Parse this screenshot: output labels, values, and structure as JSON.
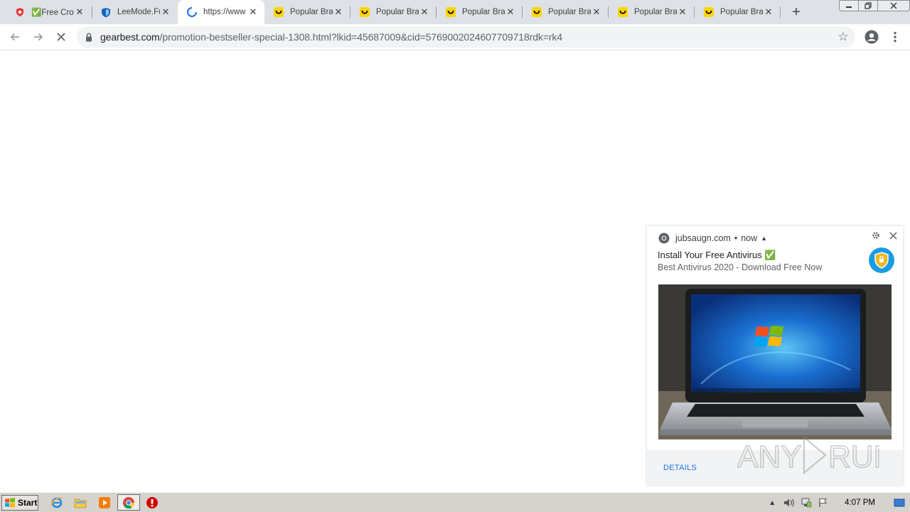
{
  "tabs": [
    {
      "title": "✅Free Cro",
      "favicon": "red-shield-icon",
      "active": false
    },
    {
      "title": "LeeMode.Fu",
      "favicon": "blue-shield-icon",
      "active": false
    },
    {
      "title": "https://www",
      "favicon": "loading-spinner-icon",
      "active": true
    },
    {
      "title": "Popular Bra",
      "favicon": "smiley-yellow-icon",
      "active": false
    },
    {
      "title": "Popular Bra",
      "favicon": "smiley-yellow-icon",
      "active": false
    },
    {
      "title": "Popular Bra",
      "favicon": "smiley-yellow-icon",
      "active": false
    },
    {
      "title": "Popular Bra",
      "favicon": "smiley-yellow-icon",
      "active": false
    },
    {
      "title": "Popular Bra",
      "favicon": "smiley-yellow-icon",
      "active": false
    },
    {
      "title": "Popular Bra",
      "favicon": "smiley-yellow-icon",
      "active": false
    }
  ],
  "omnibox": {
    "host": "gearbest.com",
    "path": "/promotion-bestseller-special-1308.html?lkid=45687009&cid=5769002024607709718rdk=rk4"
  },
  "notification": {
    "source": "jubsaugn.com",
    "time": "now",
    "title": "Install Your Free Antivirus ✅",
    "message": "Best Antivirus 2020 - Download Free Now",
    "action_label": "DETAILS"
  },
  "watermark": {
    "text": "ANY RUN"
  },
  "taskbar": {
    "start_label": "Start",
    "clock": "4:07 PM"
  },
  "colors": {
    "tabstrip": "#dee1e6",
    "accent_blue": "#1a73e8",
    "smiley_yellow": "#ffd400",
    "taskbar": "#d6d3ce"
  }
}
